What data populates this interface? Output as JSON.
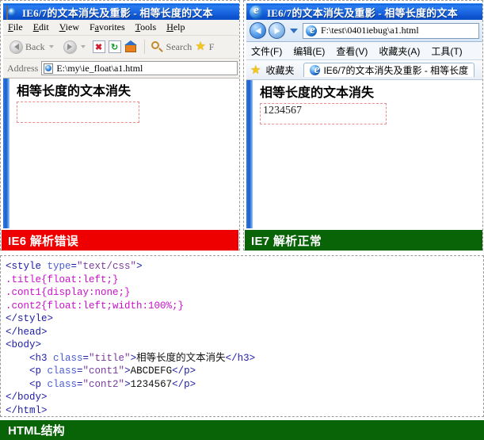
{
  "panels": {
    "ie6": {
      "window_title": "IE6/7的文本消失及重影 - 相等长度的文本",
      "menu": [
        "File",
        "Edit",
        "View",
        "Favorites",
        "Tools",
        "Help"
      ],
      "toolbar": {
        "back_label": "Back",
        "search_label": "Search",
        "favorites_label": "F",
        "icons": [
          "back-icon",
          "forward-icon",
          "stop-icon",
          "refresh-icon",
          "home-icon",
          "search-icon",
          "favorites-star-icon"
        ]
      },
      "address": {
        "label": "Address",
        "value": "E:\\my\\ie_float\\a1.html"
      },
      "page": {
        "heading": "相等长度的文本消失",
        "cont2_text": ""
      },
      "caption": "IE6 解析错误",
      "caption_color": "#ee0000"
    },
    "ie7": {
      "window_title": "IE6/7的文本消失及重影 - 相等长度的文本",
      "address": {
        "value": "F:\\test\\0401iebug\\a1.html"
      },
      "menu": [
        "文件(F)",
        "编辑(E)",
        "查看(V)",
        "收藏夹(A)",
        "工具(T)"
      ],
      "favorites_label": "收藏夹",
      "tab_label": "IE6/7的文本消失及重影 - 相等长度",
      "page": {
        "heading": "相等长度的文本消失",
        "cont2_text": "1234567"
      },
      "caption": "IE7 解析正常",
      "caption_color": "#096408"
    }
  },
  "code": {
    "caption": "HTML结构",
    "caption_color": "#096408",
    "lines": [
      "<style type=\"text/css\">",
      ".title{float:left;}",
      ".cont1{display:none;}",
      ".cont2{float:left;width:100%;}",
      "</style>",
      "</head>",
      "<body>",
      "    <h3 class=\"title\">相等长度的文本消失</h3>",
      "    <p class=\"cont1\">ABCDEFG</p>",
      "    <p class=\"cont2\">1234567</p>",
      "</body>",
      "</html>"
    ]
  }
}
